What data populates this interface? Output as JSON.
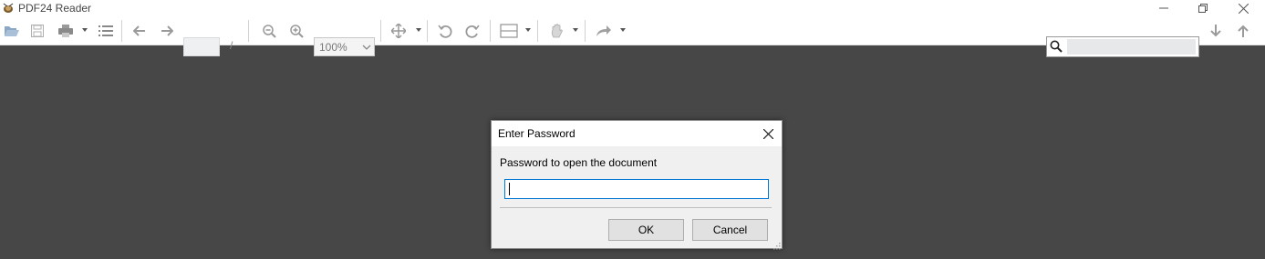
{
  "app": {
    "title": "PDF24 Reader"
  },
  "toolbar": {
    "page_input_value": "",
    "page_separator": "/",
    "zoom_value": "100%",
    "search_value": ""
  },
  "dialog": {
    "title": "Enter Password",
    "prompt": "Password to open the document",
    "password_value": "",
    "ok_label": "OK",
    "cancel_label": "Cancel"
  },
  "colors": {
    "canvas_background": "#474747",
    "toolbar_background": "#ffffff",
    "dialog_background": "#f0f0f0",
    "input_focus_border": "#0078d7"
  },
  "icons": [
    "app-icon",
    "open-icon",
    "save-icon",
    "print-icon",
    "outline-icon",
    "back-icon",
    "forward-icon",
    "zoom-out-icon",
    "zoom-in-icon",
    "move-icon",
    "rotate-left-icon",
    "rotate-right-icon",
    "fit-width-icon",
    "hand-icon",
    "share-icon",
    "search-icon",
    "arrow-down-icon",
    "arrow-up-icon",
    "close-icon",
    "minimize-icon",
    "restore-icon"
  ]
}
